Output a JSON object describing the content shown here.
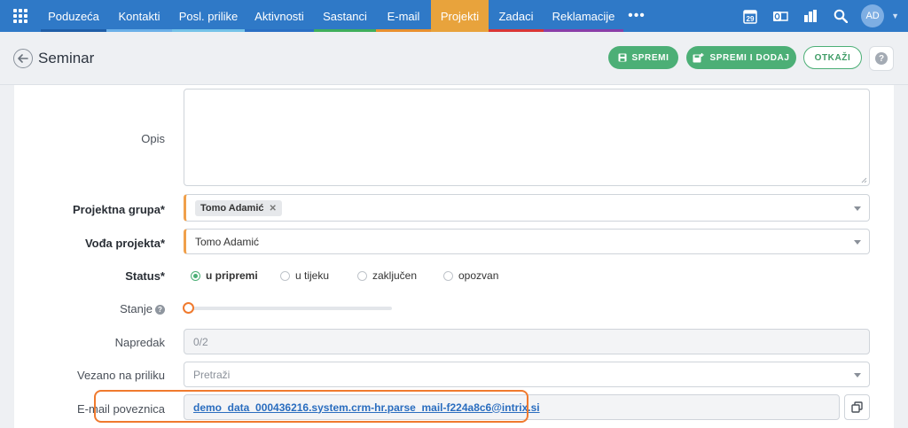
{
  "nav": {
    "tabs": [
      {
        "label": "Poduzeća",
        "color": "#1f5ea8"
      },
      {
        "label": "Kontakti",
        "color": "#6bb0e8"
      },
      {
        "label": "Posl. prilike",
        "color": "#74c2e8"
      },
      {
        "label": "Aktivnosti",
        "color": "#2a6fc4"
      },
      {
        "label": "Sastanci",
        "color": "#3fae5b"
      },
      {
        "label": "E-mail",
        "color": "#e8902f"
      },
      {
        "label": "Projekti",
        "color": "#e8a33c"
      },
      {
        "label": "Zadaci",
        "color": "#d93636"
      },
      {
        "label": "Reklamacije",
        "color": "#8a3ea8"
      }
    ],
    "more": "•••",
    "calendar_day": "29",
    "avatar": "AD"
  },
  "header": {
    "title": "Seminar",
    "save_label": "SPREMI",
    "save_add_label": "SPREMI I DODAJ",
    "cancel_label": "OTKAŽI",
    "help": "?"
  },
  "form": {
    "opis_label": "Opis",
    "projektna_grupa_label": "Projektna grupa*",
    "projektna_grupa_tag": "Tomo Adamić",
    "voda_label": "Vođa projekta*",
    "voda_value": "Tomo Adamić",
    "status_label": "Status*",
    "status_options": [
      "u pripremi",
      "u tijeku",
      "zaključen",
      "opozvan"
    ],
    "status_selected": "u pripremi",
    "stanje_label": "Stanje",
    "stanje_value": 0,
    "napredak_label": "Napredak",
    "napredak_value": "0/2",
    "vezano_label": "Vezano na priliku",
    "vezano_placeholder": "Pretraži",
    "email_label": "E-mail poveznica",
    "email_value": "demo_data_000436216.system.crm-hr.parse_mail-f224a8c6@intrix.si"
  },
  "colors": {
    "nav_bg": "#2f79c7",
    "accent_green": "#4caf76",
    "highlight_orange": "#f07a2e",
    "required_marker": "#f0a04b"
  },
  "icons": [
    "apps-grid-icon",
    "calendar-icon",
    "outlook-icon",
    "bar-chart-icon",
    "search-icon",
    "back-arrow-icon",
    "save-icon",
    "save-add-icon",
    "help-icon",
    "copy-icon"
  ]
}
